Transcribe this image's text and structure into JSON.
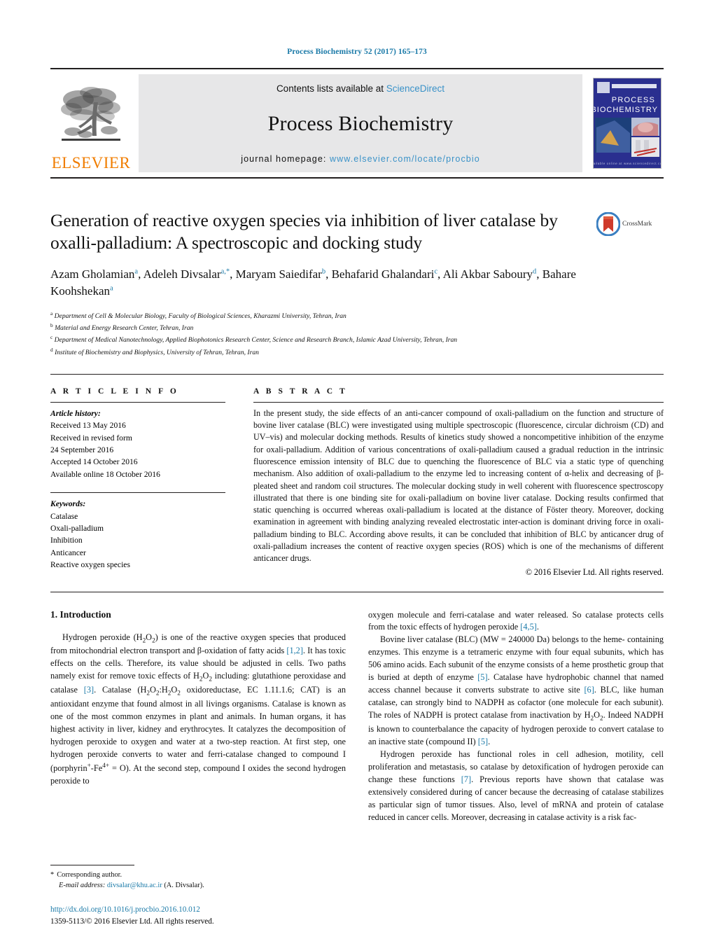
{
  "running_head": "Process Biochemistry 52 (2017) 165–173",
  "masthead": {
    "contents_prefix": "Contents lists available at ",
    "contents_link": "ScienceDirect",
    "journal_title": "Process Biochemistry",
    "homepage_prefix": "journal homepage: ",
    "homepage_url": "www.elsevier.com/locate/procbio",
    "publisher": "ELSEVIER",
    "cover_line1": "PROCESS",
    "cover_line2": "BIOCHEMISTRY"
  },
  "article": {
    "title": "Generation of reactive oxygen species via inhibition of liver catalase by oxalli-palladium: A spectroscopic and docking study",
    "crossmark_label": "CrossMark",
    "authors_html": "Azam Gholamian<sup>a</sup>, Adeleh Divsalar<sup>a,*</sup>, Maryam Saiedifar<sup>b</sup>, Behafarid Ghalandari<sup>c</sup>, Ali Akbar Saboury<sup>d</sup>, Bahare Koohshekan<sup>a</sup>",
    "affiliations": [
      {
        "marker": "a",
        "text": "Department of Cell & Molecular Biology, Faculty of Biological Sciences, Kharazmi University, Tehran, Iran"
      },
      {
        "marker": "b",
        "text": "Material and Energy Research Center, Tehran, Iran"
      },
      {
        "marker": "c",
        "text": "Department of Medical Nanotechnology, Applied Biophotonics Research Center, Science and Research Branch, Islamic Azad University, Tehran, Iran"
      },
      {
        "marker": "d",
        "text": "Institute of Biochemistry and Biophysics, University of Tehran, Tehran, Iran"
      }
    ]
  },
  "article_info": {
    "heading": "A R T I C L E    I N F O",
    "history_label": "Article history:",
    "history": [
      "Received 13 May 2016",
      "Received in revised form",
      "24 September 2016",
      "Accepted 14 October 2016",
      "Available online 18 October 2016"
    ],
    "keywords_label": "Keywords:",
    "keywords": [
      "Catalase",
      "Oxali-palladium",
      "Inhibition",
      "Anticancer",
      "Reactive oxygen species"
    ]
  },
  "abstract": {
    "heading": "A B S T R A C T",
    "text": "In the present study, the side effects of an anti-cancer compound of oxali-palladium on the function and structure of bovine liver catalase (BLC) were investigated using multiple spectroscopic (fluorescence, circular dichroism (CD) and UV–vis) and molecular docking methods. Results of kinetics study showed a noncompetitive inhibition of the enzyme for oxali-palladium. Addition of various concentrations of oxali-palladium caused a gradual reduction in the intrinsic fluorescence emission intensity of BLC due to quenching the fluorescence of BLC via a static type of quenching mechanism. Also addition of oxali-palladium to the enzyme led to increasing content of α-helix and decreasing of β-pleated sheet and random coil structures. The molecular docking study in well coherent with fluorescence spectroscopy illustrated that there is one binding site for oxali-palladium on bovine liver catalase. Docking results confirmed that static quenching is occurred whereas oxali-palladium is located at the distance of Föster theory. Moreover, docking examination in agreement with binding analyzing revealed electrostatic inter-action is dominant driving force in oxali-palladium binding to BLC. According above results, it can be concluded that inhibition of BLC by anticancer drug of oxali-palladium increases the content of reactive oxygen species (ROS) which is one of the mechanisms of different anticancer drugs.",
    "copyright": "© 2016 Elsevier Ltd. All rights reserved."
  },
  "introduction": {
    "heading": "1. Introduction",
    "left_paragraph_html": "Hydrogen peroxide (H<sub>2</sub>O<sub>2</sub>) is one of the reactive oxygen species that produced from mitochondrial electron transport and β-oxidation of fatty acids <span class=\"ref\">[1,2]</span>. It has toxic effects on the cells. Therefore, its value should be adjusted in cells. Two paths namely exist for remove toxic effects of H<sub>2</sub>O<sub>2</sub> including: glutathione peroxidase and catalase <span class=\"ref\">[3]</span>. Catalase (H<sub>2</sub>O<sub>2</sub>:H<sub>2</sub>O<sub>2</sub> oxidoreductase, EC 1.11.1.6; CAT) is an antioxidant enzyme that found almost in all livings organisms. Catalase is known as one of the most common enzymes in plant and animals. In human organs, it has highest activity in liver, kidney and erythrocytes. It catalyzes the decomposition of hydrogen peroxide to oxygen and water at a two-step reaction. At first step, one hydrogen peroxide converts to water and ferri-catalase changed to compound I (porphyrin<sup>+</sup>-Fe<sup>4+</sup> = O). At the second step, compound I oxides the second hydrogen peroxide to",
    "right_paragraph1_html": "oxygen molecule and ferri-catalase and water released. So catalase protects cells from the toxic effects of hydrogen peroxide <span class=\"ref\">[4,5]</span>.",
    "right_paragraph2_html": "Bovine liver catalase (BLC) (MW = 240000 Da) belongs to the heme- containing enzymes. This enzyme is a tetrameric enzyme with four equal subunits, which has 506 amino acids. Each subunit of the enzyme consists of a heme prosthetic group that is buried at depth of enzyme <span class=\"ref\">[5]</span>. Catalase have hydrophobic channel that named access channel because it converts substrate to active site <span class=\"ref\">[6]</span>. BLC, like human catalase, can strongly bind to NADPH as cofactor (one molecule for each subunit). The roles of NADPH is protect catalase from inactivation by H<sub>2</sub>O<sub>2</sub>. Indeed NADPH is known to counterbalance the capacity of hydrogen peroxide to convert catalase to an inactive state (compound II) <span class=\"ref\">[5]</span>.",
    "right_paragraph3_html": "Hydrogen peroxide has functional roles in cell adhesion, motility, cell proliferation and metastasis, so catalase by detoxification of hydrogen peroxide can change these functions <span class=\"ref\">[7]</span>. Previous reports have shown that catalase was extensively considered during of cancer because the decreasing of catalase stabilizes as particular sign of tumor tissues. Also, level of mRNA and protein of catalase reduced in cancer cells. Moreover, decreasing in catalase activity is a risk fac-"
  },
  "footer": {
    "corresponding_star": "*",
    "corresponding_label": "Corresponding author.",
    "email_label": "E-mail address:",
    "email": "divsalar@khu.ac.ir",
    "email_suffix": "(A. Divsalar).",
    "doi": "http://dx.doi.org/10.1016/j.procbio.2016.10.012",
    "issn_line": "1359-5113/© 2016 Elsevier Ltd. All rights reserved."
  },
  "colors": {
    "link": "#1b7aa8",
    "sciencedirect": "#3a92c8",
    "elsevier_orange": "#f07d00",
    "band_gray": "#e7e7e8"
  }
}
